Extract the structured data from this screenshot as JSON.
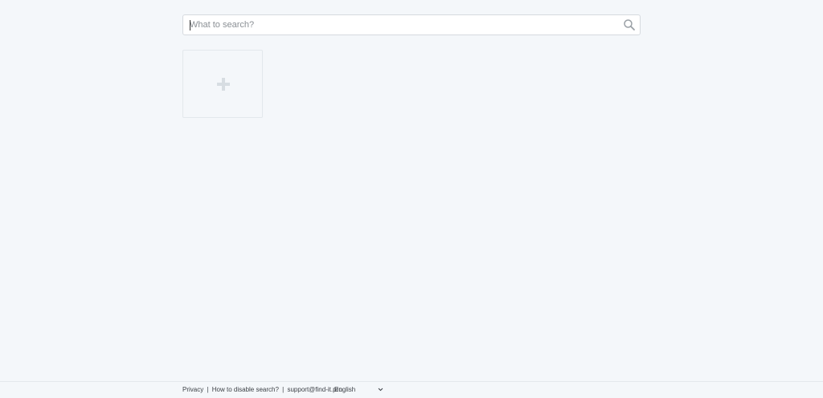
{
  "search": {
    "placeholder": "What to search?",
    "value": ""
  },
  "tiles": {
    "add_icon": "plus-icon"
  },
  "footer": {
    "links": {
      "privacy": "Privacy",
      "disable": "How to disable search?",
      "support": "support@find-it.pro"
    },
    "separator": "|",
    "language": {
      "selected": "English"
    }
  },
  "colors": {
    "background": "#f4f7fa",
    "input_border": "#d5dadf",
    "icon_gray": "#9aa0a6",
    "plus_gray": "#d7dde2"
  }
}
